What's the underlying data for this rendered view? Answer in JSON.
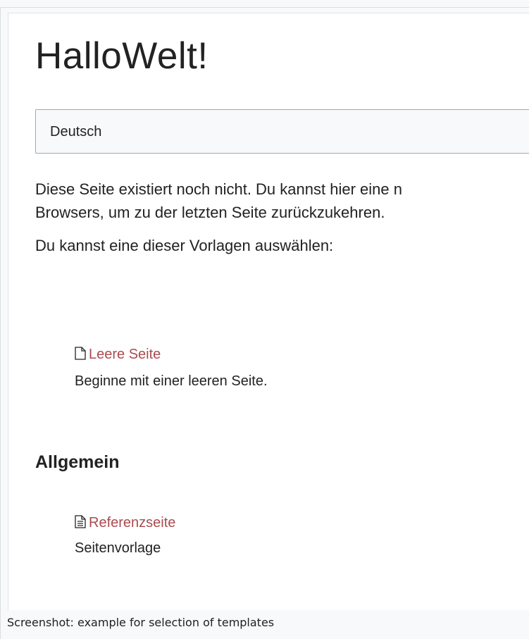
{
  "page": {
    "title": "HalloWelt!",
    "language_select": {
      "selected": "Deutsch"
    },
    "intro_line1": "Diese Seite existiert noch nicht. Du kannst hier eine n",
    "intro_line2": "Browsers, um zu der letzten Seite zurückzukehren.",
    "choose_text": "Du kannst eine dieser Vorlagen auswählen:",
    "templates": [
      {
        "icon": "blank-page-icon",
        "label": "Leere Seite",
        "description": "Beginne mit einer leeren Seite."
      }
    ],
    "sections": [
      {
        "heading": "Allgemein",
        "templates": [
          {
            "icon": "text-page-icon",
            "label": "Referenzseite",
            "description": "Seitenvorlage"
          }
        ]
      }
    ]
  },
  "caption": "Screenshot: example for selection of templates",
  "colors": {
    "link": "#ab4b50",
    "text": "#222222",
    "select_border": "#a2a9b1"
  }
}
